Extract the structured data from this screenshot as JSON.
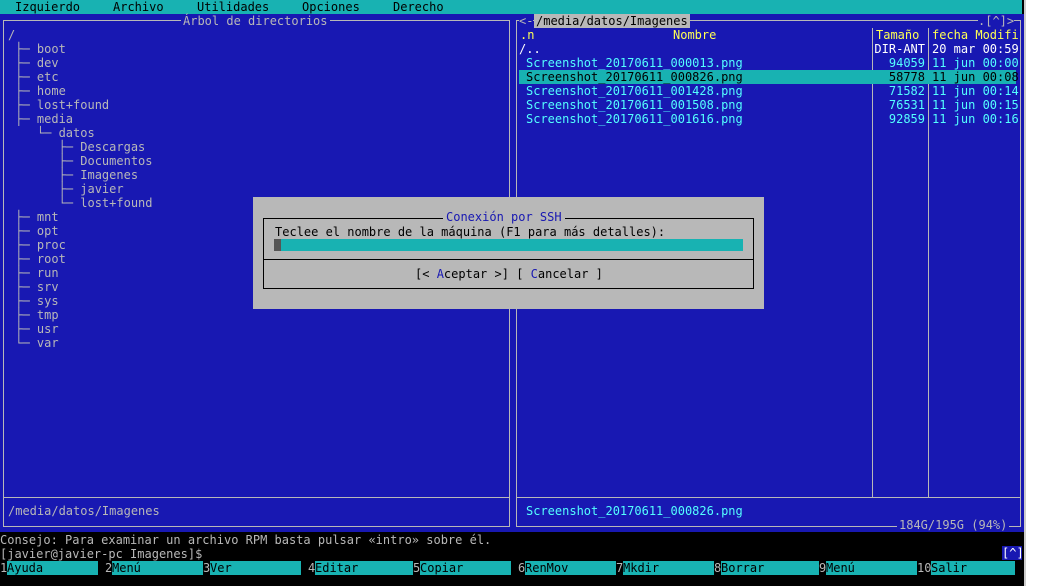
{
  "menubar": {
    "items": [
      "Izquierdo",
      "Archivo",
      "Utilidades",
      "Opciones",
      "Derecho"
    ]
  },
  "left_panel": {
    "title": "Árbol de directorios",
    "root": "/",
    "tree": [
      {
        "prefix": "├─",
        "name": "boot"
      },
      {
        "prefix": "├─",
        "name": "dev"
      },
      {
        "prefix": "├─",
        "name": "etc"
      },
      {
        "prefix": "├─",
        "name": "home"
      },
      {
        "prefix": "├─",
        "name": "lost+found"
      },
      {
        "prefix": "├─",
        "name": "media"
      },
      {
        "prefix": "   └─",
        "name": "datos"
      },
      {
        "prefix": "      ├─",
        "name": "Descargas"
      },
      {
        "prefix": "      ├─",
        "name": "Documentos"
      },
      {
        "prefix": "      ├─",
        "name": "Imagenes"
      },
      {
        "prefix": "      ├─",
        "name": "javier"
      },
      {
        "prefix": "      └─",
        "name": "lost+found"
      },
      {
        "prefix": "├─",
        "name": "mnt"
      },
      {
        "prefix": "├─",
        "name": "opt"
      },
      {
        "prefix": "├─",
        "name": "proc"
      },
      {
        "prefix": "├─",
        "name": "root"
      },
      {
        "prefix": "├─",
        "name": "run"
      },
      {
        "prefix": "├─",
        "name": "srv"
      },
      {
        "prefix": "├─",
        "name": "sys"
      },
      {
        "prefix": "├─",
        "name": "tmp"
      },
      {
        "prefix": "├─",
        "name": "usr"
      },
      {
        "prefix": "└─",
        "name": "var"
      }
    ],
    "status": "/media/datos/Imagenes"
  },
  "right_panel": {
    "title": "/media/datos/Imagenes",
    "corner_left": "<-",
    "corner_right": ".[^]>",
    "headers": {
      "sort": ".n",
      "name": "Nombre",
      "size": "Tamaño",
      "date": "fecha Modifi"
    },
    "rows": [
      {
        "name": "/..",
        "size": "DIR-ANT",
        "date": "20 mar 00:59",
        "type": "dir"
      },
      {
        "name": "Screenshot_20170611_000013.png",
        "size": "94059",
        "date": "11 jun 00:00",
        "type": "file"
      },
      {
        "name": "Screenshot_20170611_000826.png",
        "size": "58778",
        "date": "11 jun 00:08",
        "type": "selected"
      },
      {
        "name": "Screenshot_20170611_001428.png",
        "size": "71582",
        "date": "11 jun 00:14",
        "type": "file"
      },
      {
        "name": "Screenshot_20170611_001508.png",
        "size": "76531",
        "date": "11 jun 00:15",
        "type": "file"
      },
      {
        "name": "Screenshot_20170611_001616.png",
        "size": "92859",
        "date": "11 jun 00:16",
        "type": "file"
      }
    ],
    "status": "Screenshot_20170611_000826.png",
    "disk": "184G/195G (94%)"
  },
  "dialog": {
    "title": "Conexión por SSH",
    "prompt": "Teclee el nombre de la máquina (F1 para más detalles):",
    "input_value": "",
    "ok_pre": "[< ",
    "ok_hot": "A",
    "ok_rest": "ceptar >]",
    "cancel_pre": "[ ",
    "cancel_hot": "C",
    "cancel_rest": "ancelar ]"
  },
  "hint": "Consejo: Para examinar un archivo RPM basta pulsar «intro» sobre él.",
  "cmdline": "[javier@javier-pc Imagenes]$",
  "history_button": "[^]",
  "fkeys": [
    {
      "num": "1",
      "label": "Ayuda"
    },
    {
      "num": "2",
      "label": "Menú"
    },
    {
      "num": "3",
      "label": "Ver"
    },
    {
      "num": "4",
      "label": "Editar"
    },
    {
      "num": "5",
      "label": "Copiar"
    },
    {
      "num": "6",
      "label": "RenMov"
    },
    {
      "num": "7",
      "label": "Mkdir"
    },
    {
      "num": "8",
      "label": "Borrar"
    },
    {
      "num": "9",
      "label": "Menú"
    },
    {
      "num": "10",
      "label": "Salir"
    }
  ]
}
